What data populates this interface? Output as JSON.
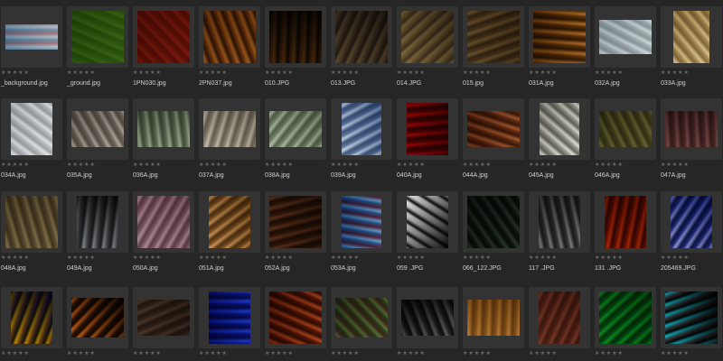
{
  "browser": {
    "rating_glyphs": "★★★★★",
    "rows": [
      {
        "items": [
          {
            "filename": "_background.jpg",
            "thumb": "flamingo-stripe",
            "colors": [
              "#87a9be",
              "#d7dde2",
              "#c6888f"
            ]
          },
          {
            "filename": "_ground.jpg",
            "thumb": "grass",
            "colors": [
              "#4f7d2a",
              "#7fa24a",
              "#5c8a33"
            ]
          },
          {
            "filename": "1PN030.jpg",
            "thumb": "red-curtain",
            "colors": [
              "#7e2c1c",
              "#b4553a",
              "#8a3824"
            ]
          },
          {
            "filename": "2PN037.jpg",
            "thumb": "leopard",
            "colors": [
              "#8a5a28",
              "#c99a58",
              "#3b2410"
            ]
          },
          {
            "filename": "010.JPG",
            "thumb": "dark-mottled",
            "colors": [
              "#1a140e",
              "#6b4e2a",
              "#a98452"
            ]
          },
          {
            "filename": "013.JPG",
            "thumb": "pebble-gravel",
            "colors": [
              "#3a332a",
              "#9b8a70",
              "#6a5c48"
            ]
          },
          {
            "filename": "014.JPG",
            "thumb": "dry-twigs",
            "colors": [
              "#5a4e3a",
              "#b8a680",
              "#8d7d5c"
            ]
          },
          {
            "filename": "015.jpg",
            "thumb": "straw",
            "colors": [
              "#6e5a3c",
              "#a4906a",
              "#4d3f2a"
            ]
          },
          {
            "filename": "031A.jpg",
            "thumb": "gold-satin",
            "colors": [
              "#6f4b1d",
              "#d6a860",
              "#3d2a12"
            ]
          },
          {
            "filename": "032A.jpg",
            "thumb": "white-silk",
            "colors": [
              "#b9c2c6",
              "#e8ecec",
              "#9ca8ac"
            ]
          },
          {
            "filename": "033A.jpg",
            "thumb": "cream-drape",
            "colors": [
              "#bba477",
              "#f0e4c4",
              "#8f7b55"
            ]
          }
        ]
      },
      {
        "items": [
          {
            "filename": "034A.jpg",
            "thumb": "white-fold",
            "colors": [
              "#c9cccf",
              "#f4f4f4",
              "#a7acb0"
            ]
          },
          {
            "filename": "035A.jpg",
            "thumb": "lace",
            "colors": [
              "#8c8680",
              "#d9d3ca",
              "#6b655f"
            ]
          },
          {
            "filename": "036A.jpg",
            "thumb": "green-lace",
            "colors": [
              "#7d8a78",
              "#c9d2c0",
              "#55614f"
            ]
          },
          {
            "filename": "037A.jpg",
            "thumb": "lace-light",
            "colors": [
              "#a29c90",
              "#e1ddd3",
              "#7a7468"
            ]
          },
          {
            "filename": "038A.jpg",
            "thumb": "mint-lace",
            "colors": [
              "#8f9a87",
              "#d6decf",
              "#6a7462"
            ]
          },
          {
            "filename": "039A.jpg",
            "thumb": "blue-drape",
            "colors": [
              "#6f86a8",
              "#e6ecf4",
              "#4c6388"
            ]
          },
          {
            "filename": "040A.jpg",
            "thumb": "red-satin",
            "colors": [
              "#6a0d10",
              "#c42a2a",
              "#3d0507"
            ]
          },
          {
            "filename": "044A.jpg",
            "thumb": "copper-silk",
            "colors": [
              "#7a4a2c",
              "#d09a70",
              "#4a2a16"
            ]
          },
          {
            "filename": "045A.jpg",
            "thumb": "white-curtain",
            "colors": [
              "#a9a9a2",
              "#f2f2ec",
              "#6f6f68"
            ]
          },
          {
            "filename": "046A.jpg",
            "thumb": "khaki-cloth",
            "colors": [
              "#6d6a45",
              "#a7a374",
              "#504e32"
            ]
          },
          {
            "filename": "047A.jpg",
            "thumb": "mauve-cloth",
            "colors": [
              "#6a4a4a",
              "#b08a86",
              "#4d3434"
            ]
          }
        ]
      },
      {
        "items": [
          {
            "filename": "048A.jpg",
            "thumb": "beige-crumple",
            "colors": [
              "#7e7258",
              "#b9ac8c",
              "#5a503c"
            ]
          },
          {
            "filename": "049A.jpg",
            "thumb": "silver-satin",
            "colors": [
              "#2a2a2c",
              "#b8babd",
              "#55575b"
            ]
          },
          {
            "filename": "050A.jpg",
            "thumb": "pink-marble",
            "colors": [
              "#9c7c86",
              "#d5c0c6",
              "#6f5560"
            ]
          },
          {
            "filename": "051A.jpg",
            "thumb": "gold-curtain",
            "colors": [
              "#8c6b3c",
              "#e6c79a",
              "#5e4422"
            ]
          },
          {
            "filename": "052A.jpg",
            "thumb": "brown-wrinkle",
            "colors": [
              "#4e3420",
              "#9a7050",
              "#2e1e12"
            ]
          },
          {
            "filename": "053A.jpg",
            "thumb": "blue-red-silk",
            "colors": [
              "#3c6c9c",
              "#a8c8e0",
              "#8a2a3a"
            ]
          },
          {
            "filename": "059 .JPG",
            "thumb": "cow-spots",
            "colors": [
              "#f4f4f4",
              "#101010",
              "#e8e8e8"
            ]
          },
          {
            "filename": "066_122.JPG",
            "thumb": "dark-green-rock",
            "colors": [
              "#26302a",
              "#6a7a68",
              "#141a16"
            ]
          },
          {
            "filename": "117 .JPG",
            "thumb": "gray-floral",
            "colors": [
              "#4a4a4a",
              "#b6b6b6",
              "#2a2a2a"
            ]
          },
          {
            "filename": "131 .JPG",
            "thumb": "orange-bark",
            "colors": [
              "#7a2a10",
              "#d0642a",
              "#3c1408"
            ]
          },
          {
            "filename": "205469.JPG",
            "thumb": "blue-pattern",
            "colors": [
              "#2a3c8a",
              "#c8c8e8",
              "#141c4a"
            ]
          }
        ]
      },
      {
        "items": [
          {
            "filename": "",
            "thumb": "yellow-plaid",
            "colors": [
              "#1a1a3a",
              "#e0c020",
              "#6a4aa0"
            ]
          },
          {
            "filename": "",
            "thumb": "tiger-stripe",
            "colors": [
              "#1a1008",
              "#e8a050",
              "#3a2410"
            ]
          },
          {
            "filename": "",
            "thumb": "brown-stone",
            "colors": [
              "#5a4a3c",
              "#8c7866",
              "#3e3228"
            ]
          },
          {
            "filename": "",
            "thumb": "blue-crumple",
            "colors": [
              "#1a2a8a",
              "#5a7ae0",
              "#0a1250"
            ]
          },
          {
            "filename": "",
            "thumb": "copper-wave",
            "colors": [
              "#6a2e14",
              "#d88a58",
              "#3e1a0a"
            ]
          },
          {
            "filename": "",
            "thumb": "green-leaf",
            "colors": [
              "#4a5a3a",
              "#9aae78",
              "#6e3a3a"
            ]
          },
          {
            "filename": "",
            "thumb": "spider-web",
            "colors": [
              "#141414",
              "#a0a0a0",
              "#3a3a3a"
            ]
          },
          {
            "filename": "",
            "thumb": "sand",
            "colors": [
              "#a07a3c",
              "#d8b070",
              "#7a5a2a"
            ]
          },
          {
            "filename": "",
            "thumb": "brick",
            "colors": [
              "#7a4a3a",
              "#b07a62",
              "#5a3428"
            ]
          },
          {
            "filename": "",
            "thumb": "green-glass",
            "colors": [
              "#0a6a2a",
              "#40c060",
              "#04401a"
            ]
          },
          {
            "filename": "",
            "thumb": "pool-light",
            "colors": [
              "#0a0a0a",
              "#40d8e0",
              "#e04040"
            ]
          }
        ]
      }
    ]
  }
}
